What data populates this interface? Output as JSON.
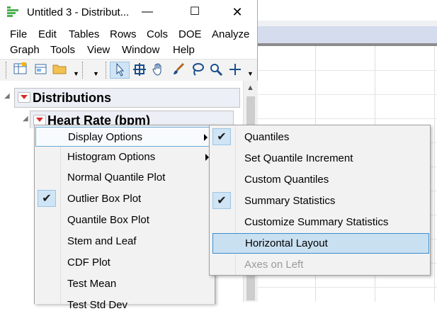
{
  "window": {
    "title": "Untitled 3 - Distribut...",
    "controls": {
      "minimize": "—",
      "maximize": "☐",
      "close": "✕"
    }
  },
  "menubar": {
    "row1": [
      "File",
      "Edit",
      "Tables",
      "Rows",
      "Cols",
      "DOE",
      "Analyze"
    ],
    "row2": [
      "Graph",
      "Tools",
      "View",
      "Window",
      "Help"
    ]
  },
  "toolbar": {
    "icons": [
      "new-data-table-icon",
      "open-icon",
      "folder-icon",
      "arrow-select-icon",
      "crosshair-icon",
      "hand-icon",
      "brush-icon",
      "lasso-icon",
      "magnifier-icon",
      "plus-icon"
    ]
  },
  "report": {
    "distributions_header": "Distributions",
    "heart_rate_header": "Heart Rate (bpm)"
  },
  "context_menu": {
    "items": [
      {
        "label": "Display Options",
        "submenu": true,
        "state": "open"
      },
      {
        "label": "Histogram Options",
        "submenu": true
      },
      {
        "label": "Normal Quantile Plot"
      },
      {
        "label": "Outlier Box Plot",
        "checked": true
      },
      {
        "label": "Quantile Box Plot"
      },
      {
        "label": "Stem and Leaf"
      },
      {
        "label": "CDF Plot"
      },
      {
        "label": "Test Mean"
      },
      {
        "label": "Test Std Dev"
      }
    ]
  },
  "submenu": {
    "items": [
      {
        "label": "Quantiles",
        "checked": true
      },
      {
        "label": "Set Quantile Increment"
      },
      {
        "label": "Custom Quantiles"
      },
      {
        "label": "Summary Statistics",
        "checked": true
      },
      {
        "label": "Customize Summary Statistics"
      },
      {
        "label": "Horizontal Layout",
        "state": "highlighted"
      },
      {
        "label": "Axes on Left",
        "disabled": true
      }
    ]
  },
  "colors": {
    "accent_highlight": "#c9e0f1",
    "check_background": "#cfe4f4",
    "red_triangle": "#d62b2b",
    "header_background": "#eceff6"
  }
}
